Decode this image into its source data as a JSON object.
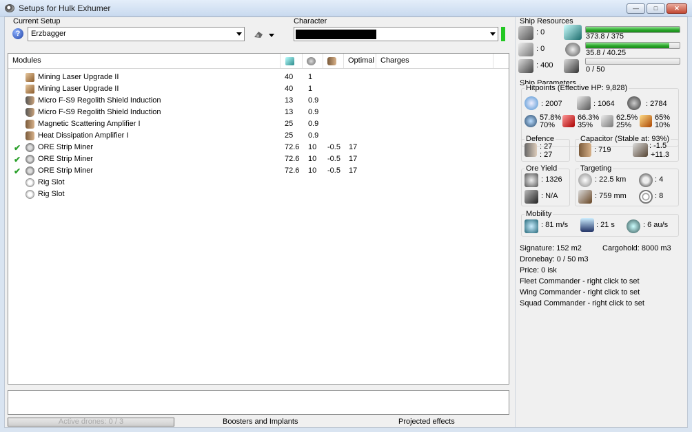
{
  "window": {
    "title": "Setups for Hulk Exhumer"
  },
  "setup": {
    "label": "Current Setup",
    "value": "Erzbagger"
  },
  "character": {
    "label": "Character"
  },
  "modules": {
    "columns": [
      "Modules",
      "",
      "",
      "",
      "Optimal",
      "Charges"
    ],
    "rows": [
      {
        "name": "Mining Laser Upgrade II",
        "cpu": "40",
        "pg": "1",
        "cap": "",
        "optimal": "",
        "icon": "mi-upgrade",
        "checked": false
      },
      {
        "name": "Mining Laser Upgrade II",
        "cpu": "40",
        "pg": "1",
        "cap": "",
        "optimal": "",
        "icon": "mi-upgrade",
        "checked": false
      },
      {
        "name": "Micro F-S9 Regolith Shield Induction",
        "cpu": "13",
        "pg": "0.9",
        "cap": "",
        "optimal": "",
        "icon": "mi-shield",
        "checked": false
      },
      {
        "name": "Micro F-S9 Regolith Shield Induction",
        "cpu": "13",
        "pg": "0.9",
        "cap": "",
        "optimal": "",
        "icon": "mi-shield",
        "checked": false
      },
      {
        "name": "Magnetic Scattering Amplifier I",
        "cpu": "25",
        "pg": "0.9",
        "cap": "",
        "optimal": "",
        "icon": "mi-heat",
        "checked": false
      },
      {
        "name": "Heat Dissipation Amplifier I",
        "cpu": "25",
        "pg": "0.9",
        "cap": "",
        "optimal": "",
        "icon": "mi-heat",
        "checked": false
      },
      {
        "name": "ORE Strip Miner",
        "cpu": "72.6",
        "pg": "10",
        "cap": "-0.5",
        "optimal": "17",
        "icon": "mi-miner",
        "checked": true
      },
      {
        "name": "ORE Strip Miner",
        "cpu": "72.6",
        "pg": "10",
        "cap": "-0.5",
        "optimal": "17",
        "icon": "mi-miner",
        "checked": true
      },
      {
        "name": "ORE Strip Miner",
        "cpu": "72.6",
        "pg": "10",
        "cap": "-0.5",
        "optimal": "17",
        "icon": "mi-miner",
        "checked": true
      },
      {
        "name": "Rig Slot",
        "cpu": "",
        "pg": "",
        "cap": "",
        "optimal": "",
        "icon": "mi-rig",
        "checked": false
      },
      {
        "name": "Rig Slot",
        "cpu": "",
        "pg": "",
        "cap": "",
        "optimal": "",
        "icon": "mi-rig",
        "checked": false
      }
    ]
  },
  "bottom": {
    "drones": "Active drones: 0 / 3",
    "boosters": "Boosters and Implants",
    "projected": "Projected effects"
  },
  "resources": {
    "title": "Ship Resources",
    "turrets": ": 0",
    "launchers": ": 0",
    "calibration": ": 400",
    "cpu_text": "373.8 / 375",
    "cpu_fraction": 0.997,
    "pg_text": "35.8 / 40.25",
    "pg_fraction": 0.889,
    "drone_text": "0 / 50",
    "drone_fraction": 0
  },
  "params": {
    "title": "Ship Parameters",
    "hitpoints_title": "Hitpoints (Effective HP: 9,828)",
    "shield_hp": ": 2007",
    "armor_hp": ": 1064",
    "structure_hp": ": 2784",
    "res1_a": "57.8%",
    "res1_b": "70%",
    "res2_a": "66.3%",
    "res2_b": "35%",
    "res3_a": "62.5%",
    "res3_b": "25%",
    "res4_a": "65%",
    "res4_b": "10%",
    "defence_title": "Defence",
    "defence_a": ": 27",
    "defence_b": ": 27",
    "capacitor_title": "Capacitor (Stable at: 93%)",
    "cap_amount": ": 719",
    "cap_delta_a": ": -1.5",
    "cap_delta_b": "+11.3",
    "ore_title": "Ore Yield",
    "ore_yield": ": 1326",
    "ore_other": ": N/A",
    "targeting_title": "Targeting",
    "target_range": ": 22.5 km",
    "max_targets": ": 4",
    "scan_res": ": 759 mm",
    "sensor_strength": ": 8",
    "mobility_title": "Mobility",
    "speed": ": 81 m/s",
    "align": ": 21 s",
    "warp": ": 6 au/s",
    "signature": "Signature: 152 m2",
    "cargohold": "Cargohold: 8000 m3",
    "dronebay": "Dronebay: 0 / 50 m3",
    "price": "Price: 0 isk",
    "fleet": "Fleet Commander - right click to set",
    "wing": "Wing Commander - right click to set",
    "squad": "Squad Commander - right click to set"
  }
}
